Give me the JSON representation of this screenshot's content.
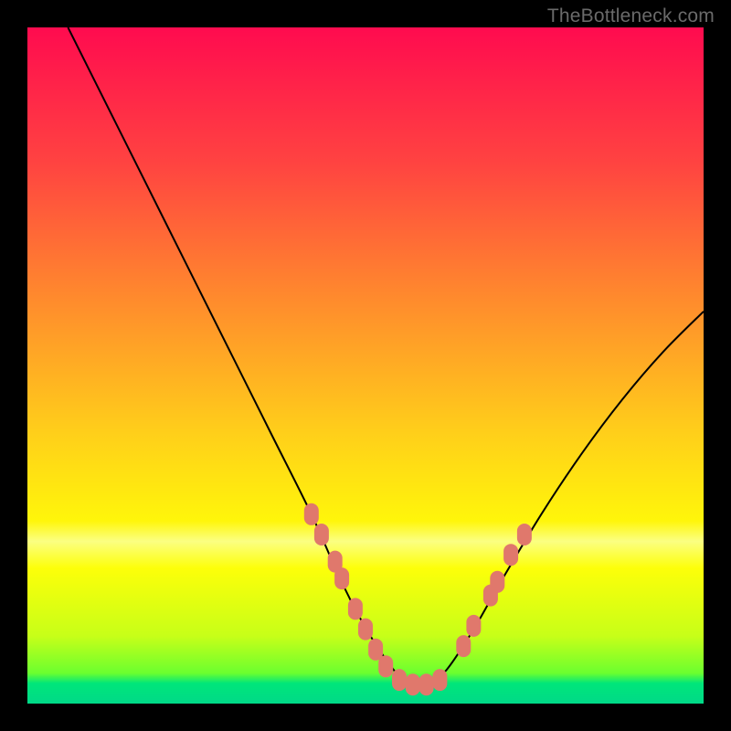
{
  "watermark": "TheBottleneck.com",
  "chart_data": {
    "type": "line",
    "title": "",
    "xlabel": "",
    "ylabel": "",
    "xlim": [
      0,
      100
    ],
    "ylim": [
      0,
      100
    ],
    "background": {
      "type": "vertical-gradient",
      "stops": [
        {
          "pos": 0.0,
          "color": "#ff0b4f"
        },
        {
          "pos": 0.2,
          "color": "#ff4341"
        },
        {
          "pos": 0.4,
          "color": "#ff8a2d"
        },
        {
          "pos": 0.6,
          "color": "#ffcf1a"
        },
        {
          "pos": 0.73,
          "color": "#fff60a"
        },
        {
          "pos": 0.76,
          "color": "#fbff82"
        },
        {
          "pos": 0.8,
          "color": "#fdff09"
        },
        {
          "pos": 0.9,
          "color": "#c7ff18"
        },
        {
          "pos": 0.955,
          "color": "#6bff2f"
        },
        {
          "pos": 0.97,
          "color": "#00e67a"
        },
        {
          "pos": 1.0,
          "color": "#00d988"
        }
      ]
    },
    "series": [
      {
        "name": "bottleneck-curve",
        "color": "#000000",
        "x": [
          6.0,
          12.0,
          18.0,
          24.0,
          30.0,
          36.0,
          42.0,
          46.0,
          49.0,
          52.0,
          55.0,
          57.0,
          59.0,
          62.0,
          66.0,
          70.0,
          76.0,
          82.0,
          88.0,
          94.0,
          100.0
        ],
        "y": [
          100.0,
          88.0,
          76.0,
          64.0,
          52.0,
          40.0,
          28.0,
          19.0,
          13.0,
          8.0,
          4.0,
          2.5,
          2.5,
          5.0,
          11.0,
          18.0,
          28.0,
          37.0,
          45.0,
          52.0,
          58.0
        ]
      }
    ],
    "markers": {
      "name": "highlighted-points",
      "color": "#e0786c",
      "shape": "rounded-rect",
      "points": [
        {
          "x": 42.0,
          "y": 28.0
        },
        {
          "x": 43.5,
          "y": 25.0
        },
        {
          "x": 45.5,
          "y": 21.0
        },
        {
          "x": 46.5,
          "y": 18.5
        },
        {
          "x": 48.5,
          "y": 14.0
        },
        {
          "x": 50.0,
          "y": 11.0
        },
        {
          "x": 51.5,
          "y": 8.0
        },
        {
          "x": 53.0,
          "y": 5.5
        },
        {
          "x": 55.0,
          "y": 3.5
        },
        {
          "x": 57.0,
          "y": 2.8
        },
        {
          "x": 59.0,
          "y": 2.8
        },
        {
          "x": 61.0,
          "y": 3.5
        },
        {
          "x": 64.5,
          "y": 8.5
        },
        {
          "x": 66.0,
          "y": 11.5
        },
        {
          "x": 68.5,
          "y": 16.0
        },
        {
          "x": 69.5,
          "y": 18.0
        },
        {
          "x": 71.5,
          "y": 22.0
        },
        {
          "x": 73.5,
          "y": 25.0
        }
      ]
    }
  }
}
